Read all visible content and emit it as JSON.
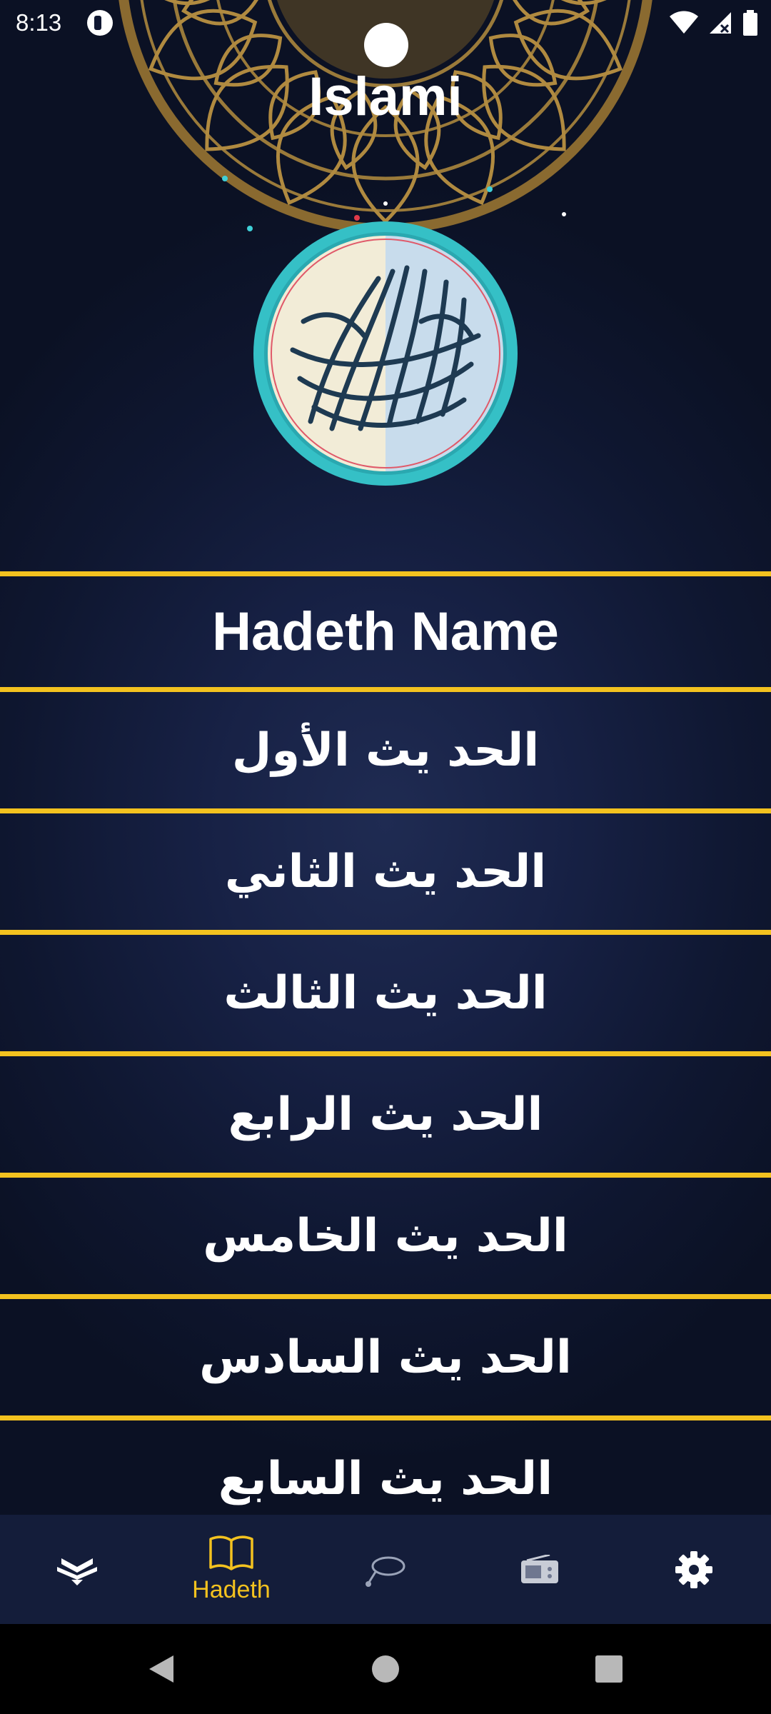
{
  "status_bar": {
    "time": "8:13"
  },
  "header": {
    "title": "Islami",
    "logo_icon": "basmala-calligraphy-emblem"
  },
  "list": {
    "header_label": "Hadeth Name",
    "items": [
      "الحد يث الأول",
      "الحد يث الثاني",
      "الحد يث الثالث",
      "الحد يث الرابع",
      "الحد يث الخامس",
      "الحد يث السادس",
      "الحد يث السابع"
    ]
  },
  "bottom_nav": {
    "items": [
      {
        "icon": "quran-book-icon",
        "label": "",
        "active": false
      },
      {
        "icon": "hadeth-book-icon",
        "label": "Hadeth",
        "active": true
      },
      {
        "icon": "sebha-beads-icon",
        "label": "",
        "active": false
      },
      {
        "icon": "radio-icon",
        "label": "",
        "active": false
      },
      {
        "icon": "settings-gear-icon",
        "label": "",
        "active": false
      }
    ]
  },
  "colors": {
    "accent": "#f3c21f",
    "background": "#172145",
    "nav_background": "#141d3a"
  }
}
